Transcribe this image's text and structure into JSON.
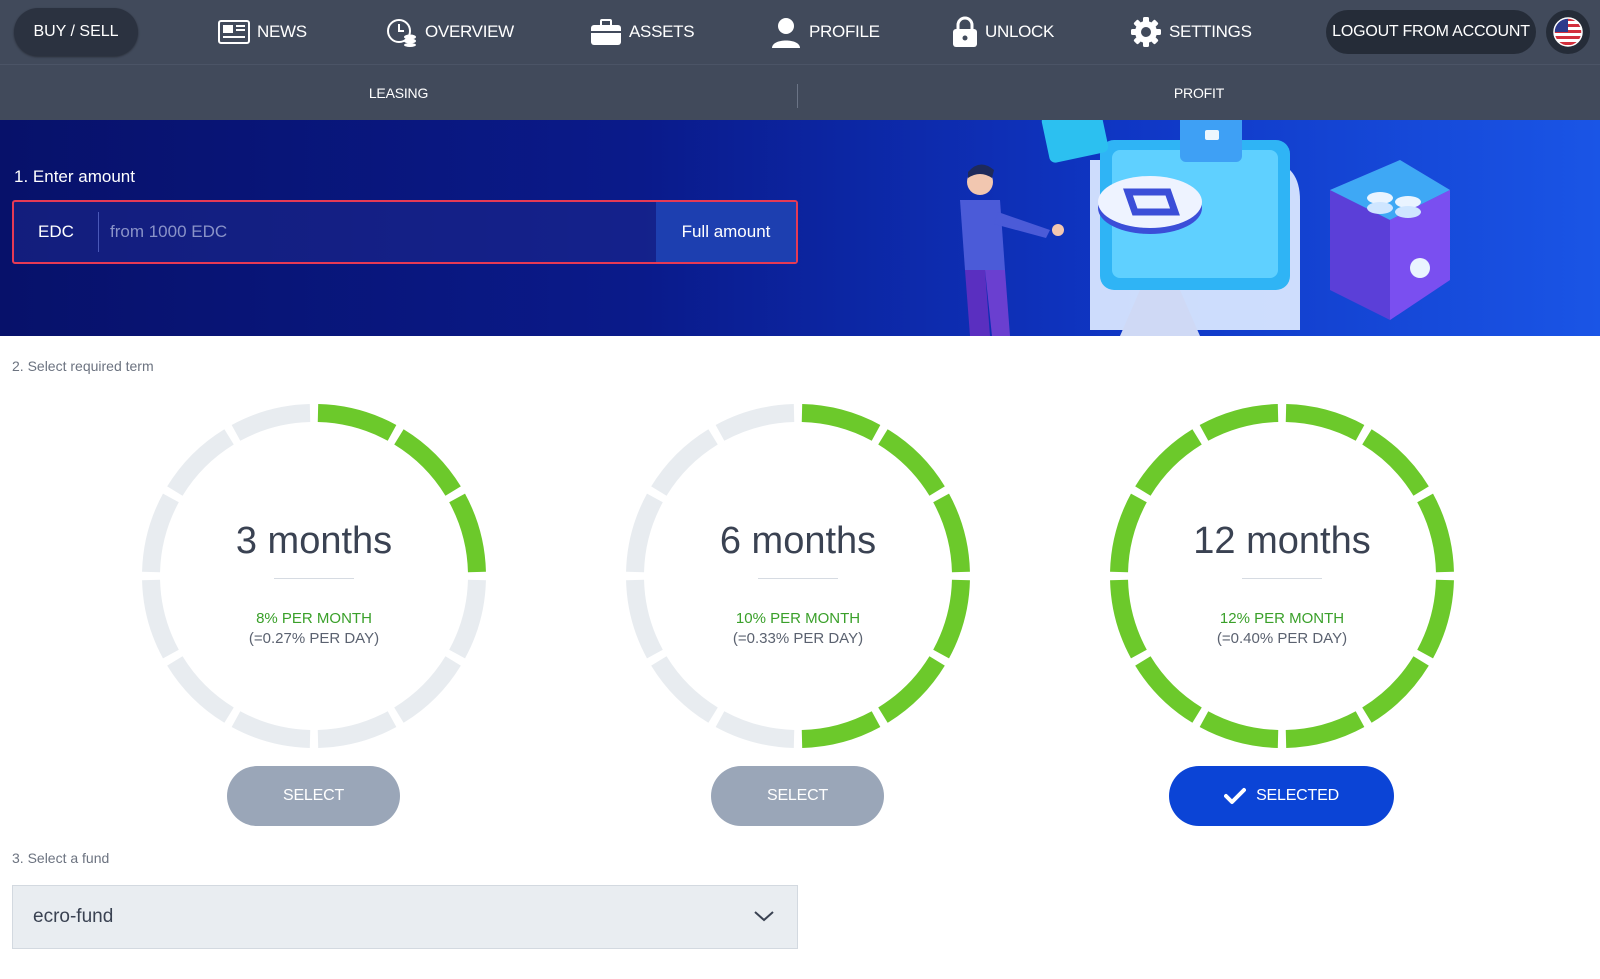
{
  "nav": {
    "buy_sell": "BUY / SELL",
    "items": [
      {
        "label": "NEWS",
        "icon": "newspaper-icon"
      },
      {
        "label": "OVERVIEW",
        "icon": "clock-coins-icon"
      },
      {
        "label": "ASSETS",
        "icon": "briefcase-icon"
      },
      {
        "label": "PROFILE",
        "icon": "user-icon"
      },
      {
        "label": "UNLOCK",
        "icon": "lock-icon"
      },
      {
        "label": "SETTINGS",
        "icon": "gear-icon"
      }
    ],
    "logout": "LOGOUT FROM ACCOUNT",
    "language_icon": "us-flag-icon"
  },
  "subnav": {
    "tabs": [
      "LEASING",
      "PROFIT"
    ]
  },
  "step1": {
    "label": "1. Enter amount",
    "currency": "EDC",
    "placeholder": "from 1000 EDC",
    "full_amount": "Full amount"
  },
  "step2": {
    "label": "2. Select required term",
    "terms": [
      {
        "title": "3 months",
        "rate": "8% PER MONTH",
        "daily": "(=0.27% PER DAY)",
        "fill_fraction": 0.25,
        "button": "SELECT",
        "selected": false
      },
      {
        "title": "6 months",
        "rate": "10% PER MONTH",
        "daily": "(=0.33% PER DAY)",
        "fill_fraction": 0.5,
        "button": "SELECT",
        "selected": false
      },
      {
        "title": "12 months",
        "rate": "12% PER MONTH",
        "daily": "(=0.40% PER DAY)",
        "fill_fraction": 1.0,
        "button": "SELECTED",
        "selected": true
      }
    ]
  },
  "step3": {
    "label": "3. Select a fund",
    "value": "ecro-fund"
  },
  "colors": {
    "header": "#414a5b",
    "ring_active": "#6cc92b",
    "ring_inactive": "#e8ecf0",
    "selected_button": "#0b44d6",
    "select_button": "#9aa6b8",
    "input_border": "#e63a55"
  }
}
